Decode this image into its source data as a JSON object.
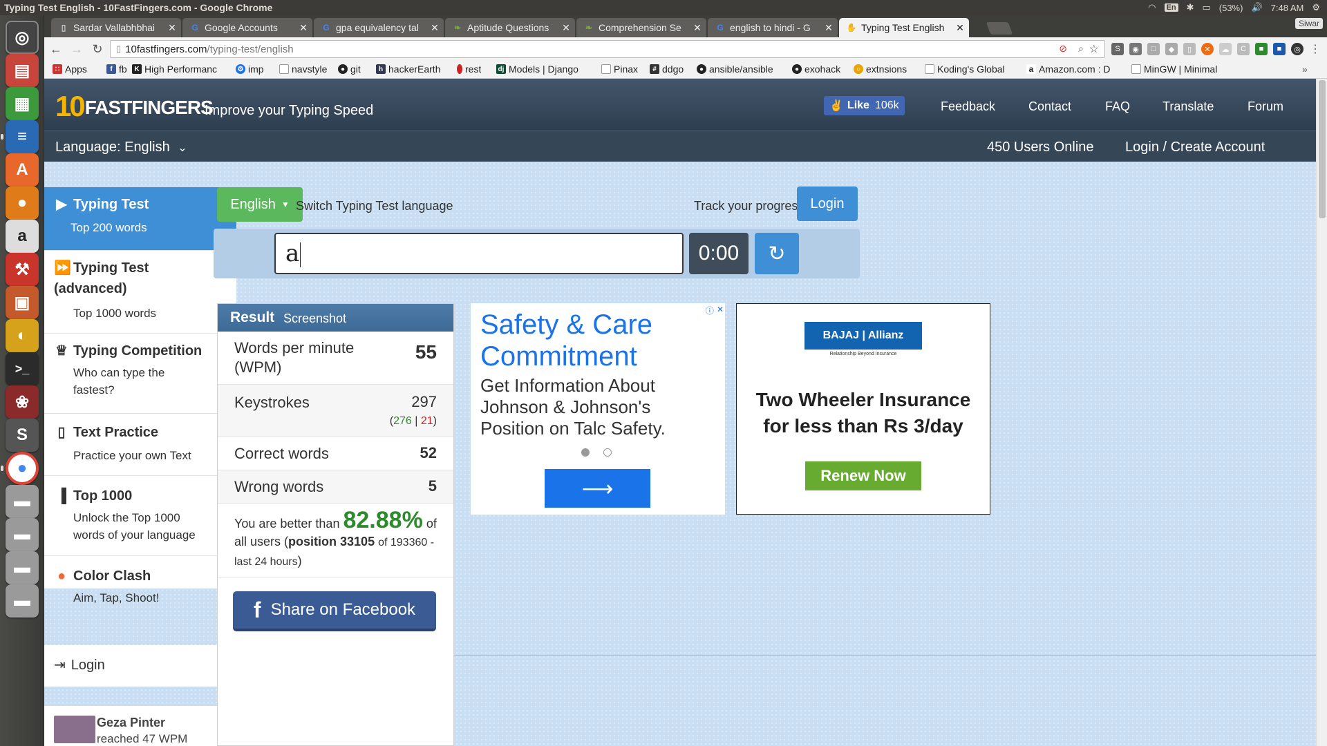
{
  "os": {
    "window_title": "Typing Test English - 10FastFingers.com - Google Chrome",
    "keyboard_layout": "En",
    "battery": "(53%)",
    "clock": "7:48 AM"
  },
  "launcher": {
    "icons": [
      "ubuntu-dash-icon",
      "files-icon",
      "spreadsheet-icon",
      "writer-icon",
      "software-center-icon",
      "firefox-icon",
      "amazon-icon",
      "system-settings-icon",
      "presentation-icon",
      "eclipse-icon",
      "terminal-icon",
      "game-icon",
      "sublime-text-icon",
      "chrome-icon",
      "drive-icon",
      "drive-icon",
      "drive-icon",
      "drive-icon"
    ]
  },
  "browser": {
    "tabs": [
      {
        "label": "Sardar Vallabhbhai",
        "icon": "page-icon",
        "active": false
      },
      {
        "label": "Google Accounts",
        "icon": "google-icon",
        "active": false
      },
      {
        "label": "gpa equivalency tal",
        "icon": "google-icon",
        "active": false
      },
      {
        "label": "Aptitude Questions",
        "icon": "indiabix-icon",
        "active": false
      },
      {
        "label": "Comprehension Se",
        "icon": "indiabix-icon",
        "active": false
      },
      {
        "label": "english to hindi - G",
        "icon": "google-icon",
        "active": false
      },
      {
        "label": "Typing Test English",
        "icon": "10ff-icon",
        "active": true
      }
    ],
    "profile_name": "Siwar",
    "url_host": "10fastfingers.com",
    "url_path": "/typing-test/english",
    "bookmarks": [
      {
        "label": "Apps",
        "icon": "apps-icon",
        "color": "#c33"
      },
      {
        "label": "fb",
        "icon": "facebook-icon",
        "color": "#3b5998"
      },
      {
        "label": "High Performanc",
        "icon": "k-icon",
        "color": "#333"
      },
      {
        "label": "imp",
        "icon": "gear-icon",
        "color": "#1a73e8"
      },
      {
        "label": "navstyle",
        "icon": "page-icon",
        "color": "#999"
      },
      {
        "label": "git",
        "icon": "github-icon",
        "color": "#222"
      },
      {
        "label": "hackerEarth",
        "icon": "hackerearth-icon",
        "color": "#323754"
      },
      {
        "label": "rest",
        "icon": "pin-icon",
        "color": "#c22"
      },
      {
        "label": "Models | Django",
        "icon": "django-icon",
        "color": "#0c4b33"
      },
      {
        "label": "Pinax",
        "icon": "page-icon",
        "color": "#999"
      },
      {
        "label": "ddgo",
        "icon": "hash-icon",
        "color": "#333"
      },
      {
        "label": "ansible/ansible",
        "icon": "github-icon",
        "color": "#222"
      },
      {
        "label": "exohack",
        "icon": "github-icon",
        "color": "#222"
      },
      {
        "label": "extnsions",
        "icon": "globe-icon",
        "color": "#e8a400"
      },
      {
        "label": "Koding's Global",
        "icon": "page-icon",
        "color": "#999"
      },
      {
        "label": "Amazon.com : D",
        "icon": "amazon-icon",
        "color": "#222"
      },
      {
        "label": "MinGW | Minimal",
        "icon": "page-icon",
        "color": "#999"
      }
    ]
  },
  "site": {
    "logo_ten": "10",
    "logo_text": "FASTFINGERS",
    "tagline": "Improve your Typing Speed",
    "fb_like_label": "Like",
    "fb_like_count": "106k",
    "nav": [
      "Feedback",
      "Contact",
      "FAQ",
      "Translate",
      "Forum"
    ],
    "language_label": "Language: English",
    "users_online": "450 Users Online",
    "login_create": "Login / Create Account"
  },
  "sidebar": {
    "items": [
      {
        "title": "Typing Test",
        "sub": "Top 200 words",
        "icon": "play-icon"
      },
      {
        "title": "Typing Test (advanced)",
        "sub": "Top 1000 words",
        "icon": "fast-forward-icon"
      },
      {
        "title": "Typing Competition",
        "sub": "Who can type the fastest?",
        "icon": "trophy-icon"
      },
      {
        "title": "Text Practice",
        "sub": "Practice your own Text",
        "icon": "document-icon"
      },
      {
        "title": "Top 1000",
        "sub": "Unlock the Top 1000 words of your language",
        "icon": "signal-icon"
      },
      {
        "title": "Color Clash",
        "sub": "Aim, Tap, Shoot!",
        "icon": "red-dot-icon"
      }
    ],
    "login_label": "Login",
    "recent_name": "Geza Pinter",
    "recent_text": "reached 47 WPM"
  },
  "test": {
    "language_button": "English",
    "switch_text": "Switch Typing Test language",
    "track_text": "Track your progress:",
    "login_button": "Login",
    "input_value": "a",
    "timer": "0:00"
  },
  "result": {
    "header": "Result",
    "screenshot_tab": "Screenshot",
    "wpm_label": "Words per minute (WPM)",
    "wpm_value": "55",
    "keystrokes_label": "Keystrokes",
    "keystrokes_value": "297",
    "keystrokes_correct": "276",
    "keystrokes_sep": "|",
    "keystrokes_wrong": "21",
    "correct_label": "Correct words",
    "correct_value": "52",
    "wrong_label": "Wrong words",
    "wrong_value": "5",
    "better_prefix": "You are better than",
    "better_pct": "82.88%",
    "better_suffix": "of all users",
    "position_label": "position 33105",
    "position_rest": "of 193360 - last 24 hours",
    "share_label": "Share on Facebook"
  },
  "ads": {
    "ad1_title": "Safety & Care Commitment",
    "ad1_body": "Get Information About Johnson & Johnson's Position on Talc Safety.",
    "ad2_brand": "BAJAJ | Allianz",
    "ad2_tagline": "Relationship Beyond Insurance",
    "ad2_headline": "Two Wheeler Insurance for less than Rs 3/day",
    "ad2_button": "Renew Now"
  }
}
